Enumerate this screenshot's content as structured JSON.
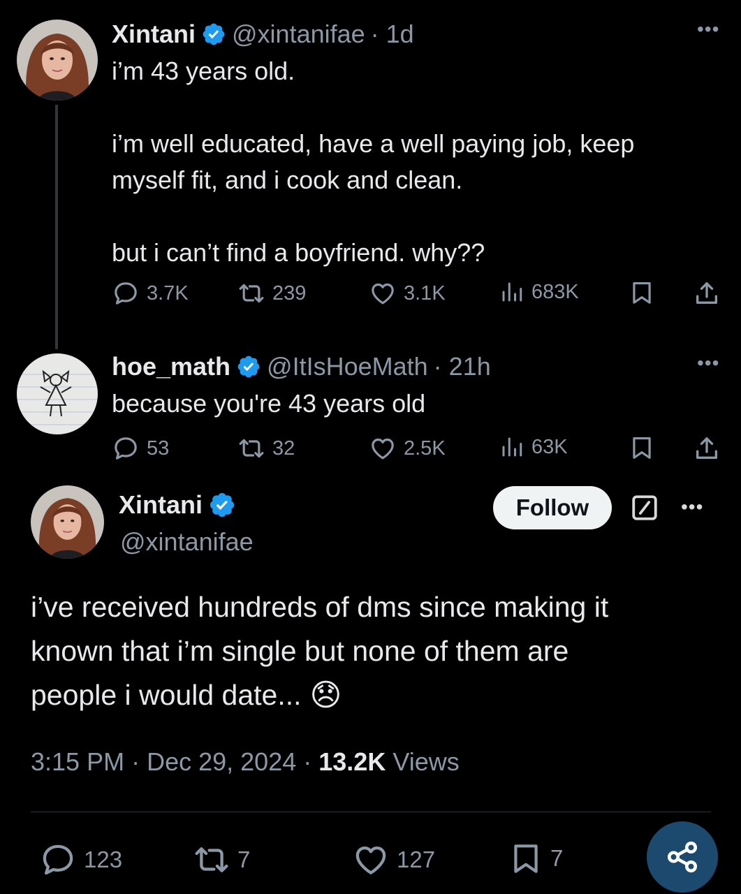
{
  "tweet1": {
    "name": "Xintani",
    "handle": "@xintanifae",
    "time": "· 1d",
    "lines": [
      "i’m 43 years old.",
      "i’m well educated, have a well paying job, keep",
      "myself fit, and i cook and clean.",
      "but i can’t find a boyfriend. why??"
    ],
    "replies": "3.7K",
    "reposts": "239",
    "likes": "3.1K",
    "views": "683K"
  },
  "tweet2": {
    "name": "hoe_math",
    "handle": "@ItIsHoeMath",
    "time": "· 21h",
    "text": "because you're 43 years old",
    "replies": "53",
    "reposts": "32",
    "likes": "2.5K",
    "views": "63K"
  },
  "main": {
    "name": "Xintani",
    "handle": "@xintanifae",
    "follow_label": "Follow",
    "lines": [
      "i’ve received hundreds of dms since making it",
      "known that i’m single but none of them are",
      "people i would date..."
    ],
    "emoji": "😞",
    "time": "3:15 PM",
    "date": "Dec 29, 2024",
    "views_count": "13.2K",
    "views_label": "Views",
    "replies": "123",
    "reposts": "7",
    "likes": "127",
    "bookmarks": "7"
  },
  "icons": {
    "verified": "verified-badge-icon",
    "reply": "reply-bubble-icon",
    "repost": "repost-arrows-icon",
    "like": "heart-icon",
    "views": "bar-chart-icon",
    "bookmark": "bookmark-icon",
    "share": "share-upload-icon",
    "share_fab": "share-nodes-icon",
    "grok": "grok-slash-icon",
    "more": "more-dots-icon"
  },
  "colors": {
    "background": "#000000",
    "text": "#e7e9ea",
    "secondary": "#8b98a5",
    "verified": "#1d9bf0",
    "fab": "#1b4a6e"
  }
}
